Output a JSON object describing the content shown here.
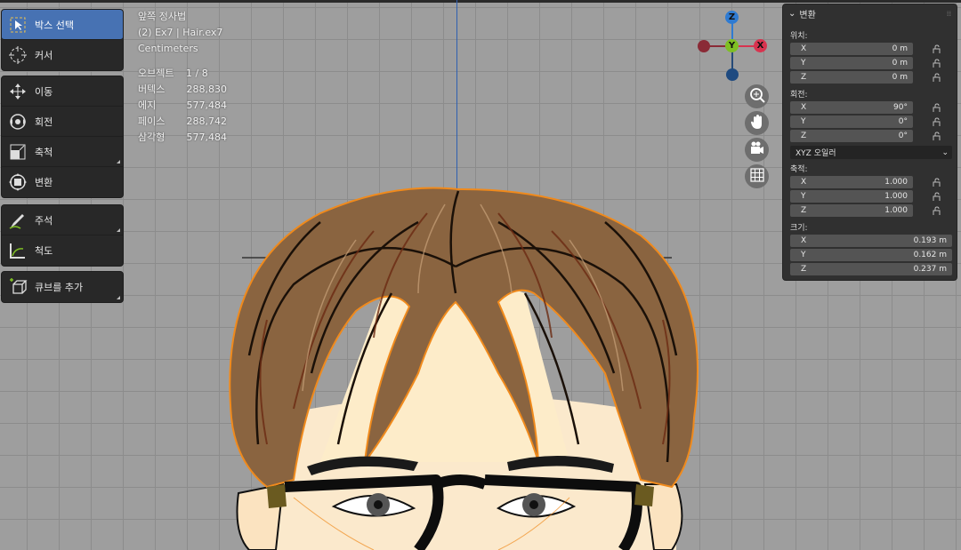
{
  "toolbar": {
    "groups": [
      [
        {
          "label": "박스 선택",
          "icon": "box-select-icon",
          "active": true
        },
        {
          "label": "커서",
          "icon": "cursor-icon",
          "active": false
        }
      ],
      [
        {
          "label": "이동",
          "icon": "move-icon",
          "active": false
        },
        {
          "label": "회전",
          "icon": "rotate-icon",
          "active": false
        },
        {
          "label": "축척",
          "icon": "scale-icon",
          "active": false
        },
        {
          "label": "변환",
          "icon": "transform-icon",
          "active": false
        }
      ],
      [
        {
          "label": "주석",
          "icon": "annotate-icon",
          "active": false
        },
        {
          "label": "척도",
          "icon": "measure-icon",
          "active": false
        }
      ],
      [
        {
          "label": "큐브를 추가",
          "icon": "add-cube-icon",
          "active": false
        }
      ]
    ]
  },
  "overlay": {
    "view_name": "앞쪽 정사법",
    "object_name": "(2) Ex7 | Hair.ex7",
    "units": "Centimeters",
    "stats": [
      {
        "label": "오브젝트",
        "value": "1 / 8"
      },
      {
        "label": "버텍스",
        "value": "288,830"
      },
      {
        "label": "에지",
        "value": "577,484"
      },
      {
        "label": "페이스",
        "value": "288,742"
      },
      {
        "label": "삼각형",
        "value": "577,484"
      }
    ]
  },
  "gizmo": {
    "z_label": "Z",
    "y_label": "Y",
    "x_label": "X",
    "colors": {
      "x": "#d8334f",
      "y": "#7fbf24",
      "z": "#2f7bd2"
    }
  },
  "nav_buttons": [
    "zoom-icon",
    "hand-icon",
    "camera-icon",
    "grid-icon"
  ],
  "npanel": {
    "title": "변환",
    "location_label": "위치:",
    "location": [
      {
        "axis": "X",
        "value": "0 m"
      },
      {
        "axis": "Y",
        "value": "0 m"
      },
      {
        "axis": "Z",
        "value": "0 m"
      }
    ],
    "rotation_label": "회전:",
    "rotation": [
      {
        "axis": "X",
        "value": "90°"
      },
      {
        "axis": "Y",
        "value": "0°"
      },
      {
        "axis": "Z",
        "value": "0°"
      }
    ],
    "rotation_mode": "XYZ 오일러",
    "scale_label": "축적:",
    "scale": [
      {
        "axis": "X",
        "value": "1.000"
      },
      {
        "axis": "Y",
        "value": "1.000"
      },
      {
        "axis": "Z",
        "value": "1.000"
      }
    ],
    "dimensions_label": "크기:",
    "dimensions": [
      {
        "axis": "X",
        "value": "0.193 m"
      },
      {
        "axis": "Y",
        "value": "0.162 m"
      },
      {
        "axis": "Z",
        "value": "0.237 m"
      }
    ]
  },
  "colors": {
    "accent": "#4772b3",
    "outline": "#f08a1c",
    "hair": "#8a6440"
  }
}
